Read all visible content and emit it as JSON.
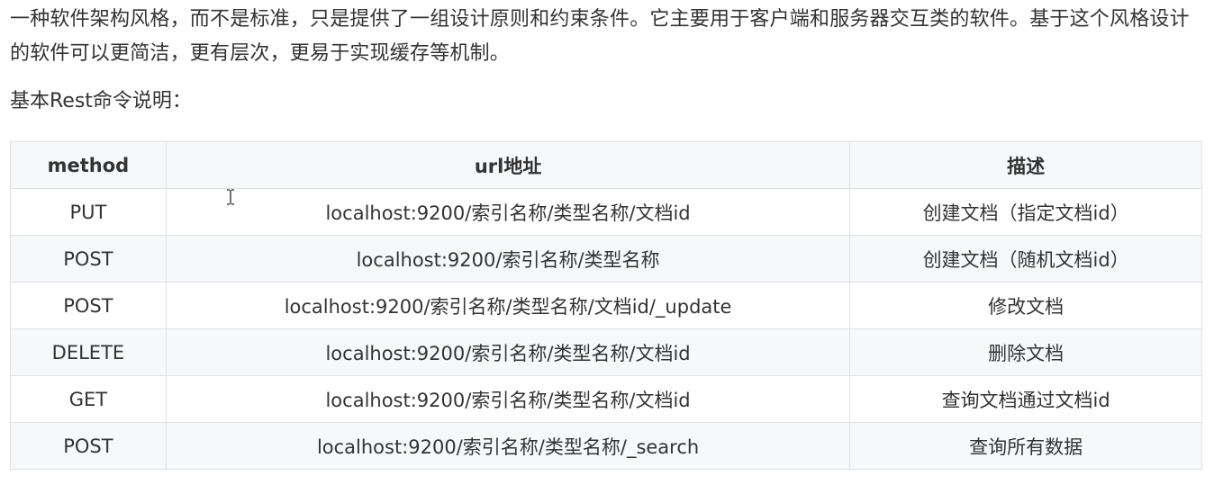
{
  "intro": {
    "paragraph": "一种软件架构风格，而不是标准，只是提供了一组设计原则和约束条件。它主要用于客户端和服务器交互类的软件。基于这个风格设计的软件可以更简洁，更有层次，更易于实现缓存等机制。"
  },
  "subtitle": "基本Rest命令说明：",
  "table": {
    "headers": {
      "method": "method",
      "url": "url地址",
      "description": "描述"
    },
    "rows": [
      {
        "method": "PUT",
        "url": "localhost:9200/索引名称/类型名称/文档id",
        "description": "创建文档（指定文档id）"
      },
      {
        "method": "POST",
        "url": "localhost:9200/索引名称/类型名称",
        "description": "创建文档（随机文档id）"
      },
      {
        "method": "POST",
        "url": "localhost:9200/索引名称/类型名称/文档id/_update",
        "description": "修改文档"
      },
      {
        "method": "DELETE",
        "url": "localhost:9200/索引名称/类型名称/文档id",
        "description": "删除文档"
      },
      {
        "method": "GET",
        "url": "localhost:9200/索引名称/类型名称/文档id",
        "description": "查询文档通过文档id"
      },
      {
        "method": "POST",
        "url": "localhost:9200/索引名称/类型名称/_search",
        "description": "查询所有数据"
      }
    ]
  },
  "cursor": {
    "icon": "text-cursor-icon"
  }
}
